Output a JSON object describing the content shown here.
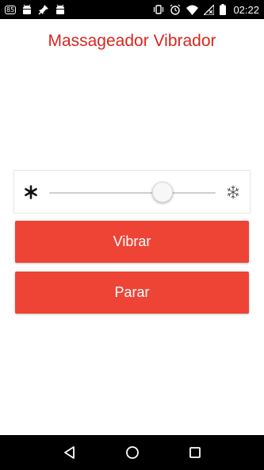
{
  "status_bar": {
    "badge": "85",
    "time": "02:22",
    "left_icons": [
      "notification-badge-icon",
      "android-icon",
      "pin-icon",
      "android-icon"
    ],
    "right_icons": [
      "vibrate-icon",
      "alarm-icon",
      "wifi-icon",
      "no-sim-icon",
      "battery-icon"
    ]
  },
  "app": {
    "title": "Massageador Vibrador",
    "title_color": "#d7261e"
  },
  "intensity_slider": {
    "value_fraction": 0.68,
    "low_icon": "asterisk-bold-icon",
    "high_icon": "snowflake-outline-icon"
  },
  "buttons": {
    "vibrar_label": "Vibrar",
    "parar_label": "Parar",
    "color": "#ee4435"
  },
  "nav_bar": {
    "icons": [
      "back-icon",
      "home-icon",
      "recents-icon"
    ]
  }
}
